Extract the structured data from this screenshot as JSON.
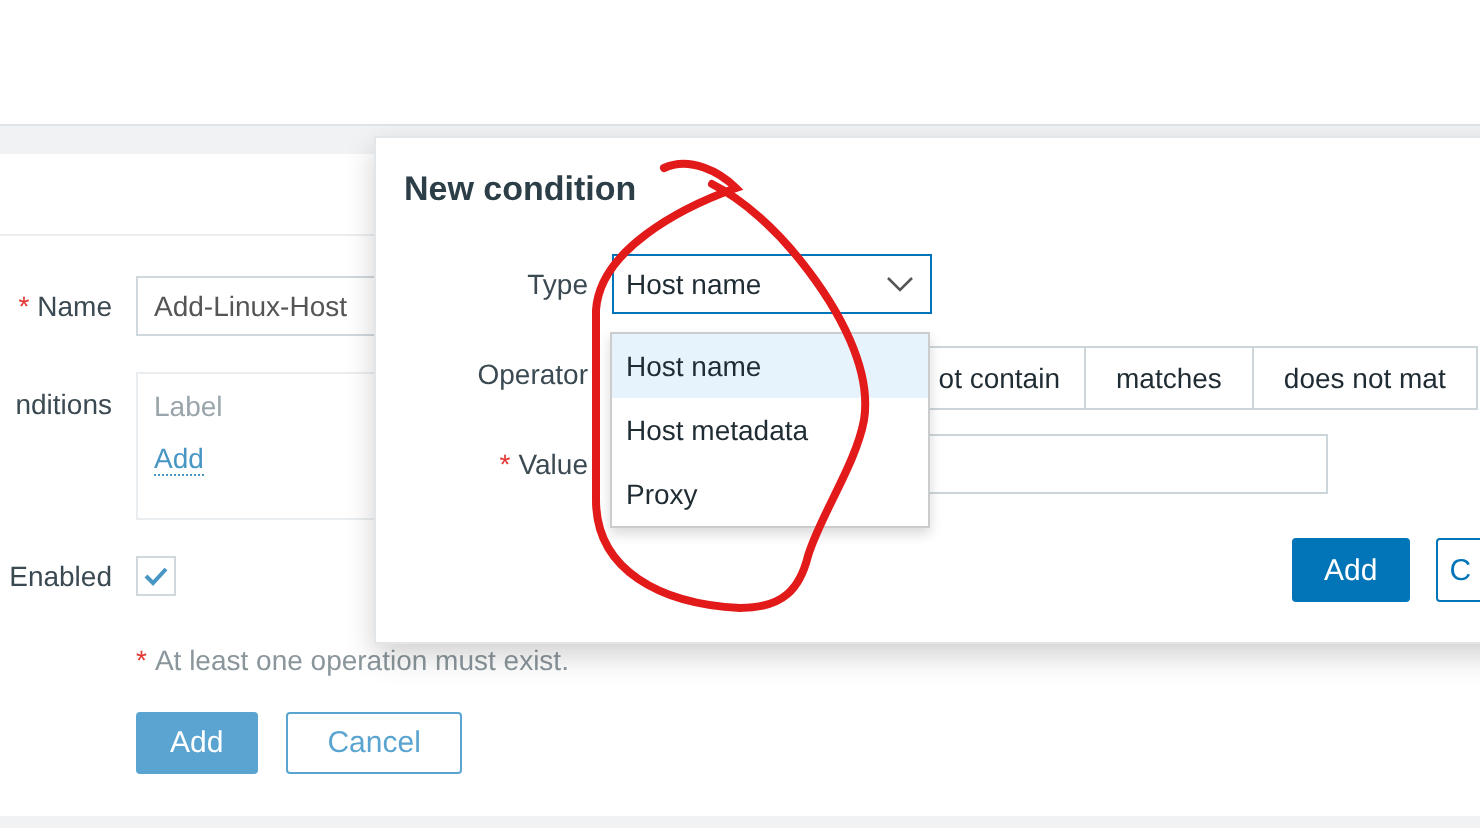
{
  "form": {
    "name": {
      "label": "Name",
      "required_mark": "*",
      "value": "Add-Linux-Host"
    },
    "conditions": {
      "label": "nditions",
      "column_header": "Label",
      "add_link": "Add"
    },
    "enabled": {
      "label": "Enabled",
      "checked": true
    },
    "note": {
      "text": "At least one operation must exist.",
      "required_mark": "*"
    },
    "buttons": [
      {
        "label": "Add",
        "kind": "primary"
      },
      {
        "label": "Cancel",
        "kind": "secondary"
      }
    ]
  },
  "dialog": {
    "title": "New condition",
    "type": {
      "label": "Type",
      "value": "Host name",
      "expanded": true,
      "options": [
        {
          "label": "Host name",
          "selected": true
        },
        {
          "label": "Host metadata",
          "selected": false
        },
        {
          "label": "Proxy",
          "selected": false
        }
      ]
    },
    "operator": {
      "label": "Operator",
      "options": [
        {
          "label": "ot contain",
          "selected": false
        },
        {
          "label": "matches",
          "selected": false
        },
        {
          "label": "does not mat",
          "selected": false
        }
      ]
    },
    "value": {
      "label": "Value",
      "required_mark": "*"
    },
    "buttons": [
      {
        "label": "Add",
        "kind": "primary"
      },
      {
        "label": "C",
        "kind": "secondary"
      }
    ]
  }
}
